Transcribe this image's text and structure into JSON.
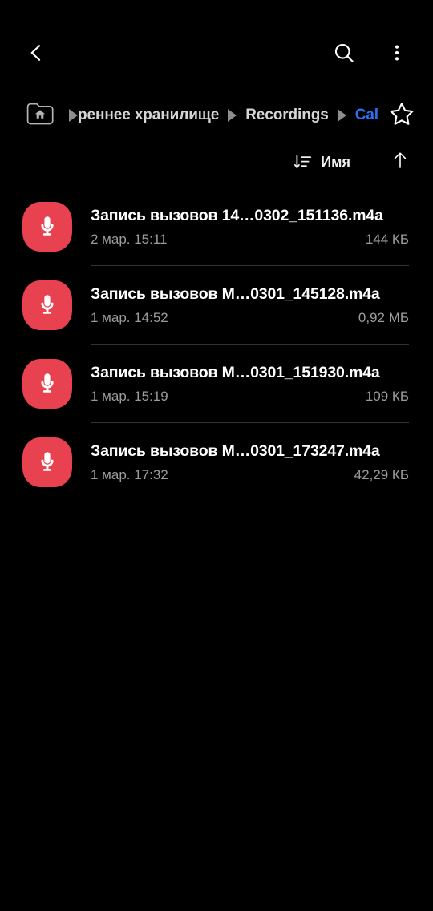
{
  "appbar": {
    "back_icon": "chevron-left-icon",
    "search_icon": "search-icon",
    "more_icon": "more-vertical-icon"
  },
  "breadcrumb": {
    "home_icon": "home-folder-icon",
    "star_icon": "star-outline-icon",
    "items": [
      {
        "label": "реннее хранилище",
        "current": false,
        "truncated": true
      },
      {
        "label": "Recordings",
        "current": false,
        "truncated": false
      },
      {
        "label": "Call",
        "current": true,
        "truncated": false
      }
    ]
  },
  "sortbar": {
    "sort_icon": "sort-descending-icon",
    "sort_label": "Имя",
    "direction_icon": "arrow-up-icon"
  },
  "files": [
    {
      "icon": "microphone-icon",
      "name": "Запись вызовов 14…0302_151136.m4a",
      "date": "2 мар. 15:11",
      "size": "144 КБ"
    },
    {
      "icon": "microphone-icon",
      "name": "Запись вызовов M…0301_145128.m4a",
      "date": "1 мар. 14:52",
      "size": "0,92 МБ"
    },
    {
      "icon": "microphone-icon",
      "name": "Запись вызовов M…0301_151930.m4a",
      "date": "1 мар. 15:19",
      "size": "109 КБ"
    },
    {
      "icon": "microphone-icon",
      "name": "Запись вызовов M…0301_173247.m4a",
      "date": "1 мар. 17:32",
      "size": "42,29 КБ"
    }
  ],
  "colors": {
    "background": "#000000",
    "accent_blue": "#2f6ff0",
    "icon_red": "#e8414f",
    "primary_text": "#ffffff",
    "secondary_text": "#9b9b9b",
    "divider": "#333333"
  }
}
